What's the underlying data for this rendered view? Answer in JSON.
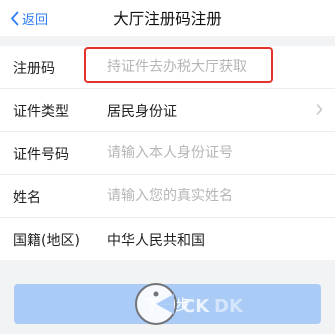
{
  "nav": {
    "back_label": "返回",
    "title": "大厅注册码注册"
  },
  "form": {
    "rows": [
      {
        "label": "注册码",
        "placeholder": "持证件去办税大厅获取"
      },
      {
        "label": "证件类型",
        "value": "居民身份证"
      },
      {
        "label": "证件号码",
        "placeholder": "请输入本人身份证号"
      },
      {
        "label": "姓名",
        "placeholder": "请输入您的真实姓名"
      },
      {
        "label": "国籍(地区)",
        "value": "中华人民共和国"
      }
    ]
  },
  "submit": {
    "label": "下一步"
  },
  "colors": {
    "accent": "#2f7df6",
    "highlight_border": "#e5332a",
    "button_disabled": "#a9cbf6"
  }
}
